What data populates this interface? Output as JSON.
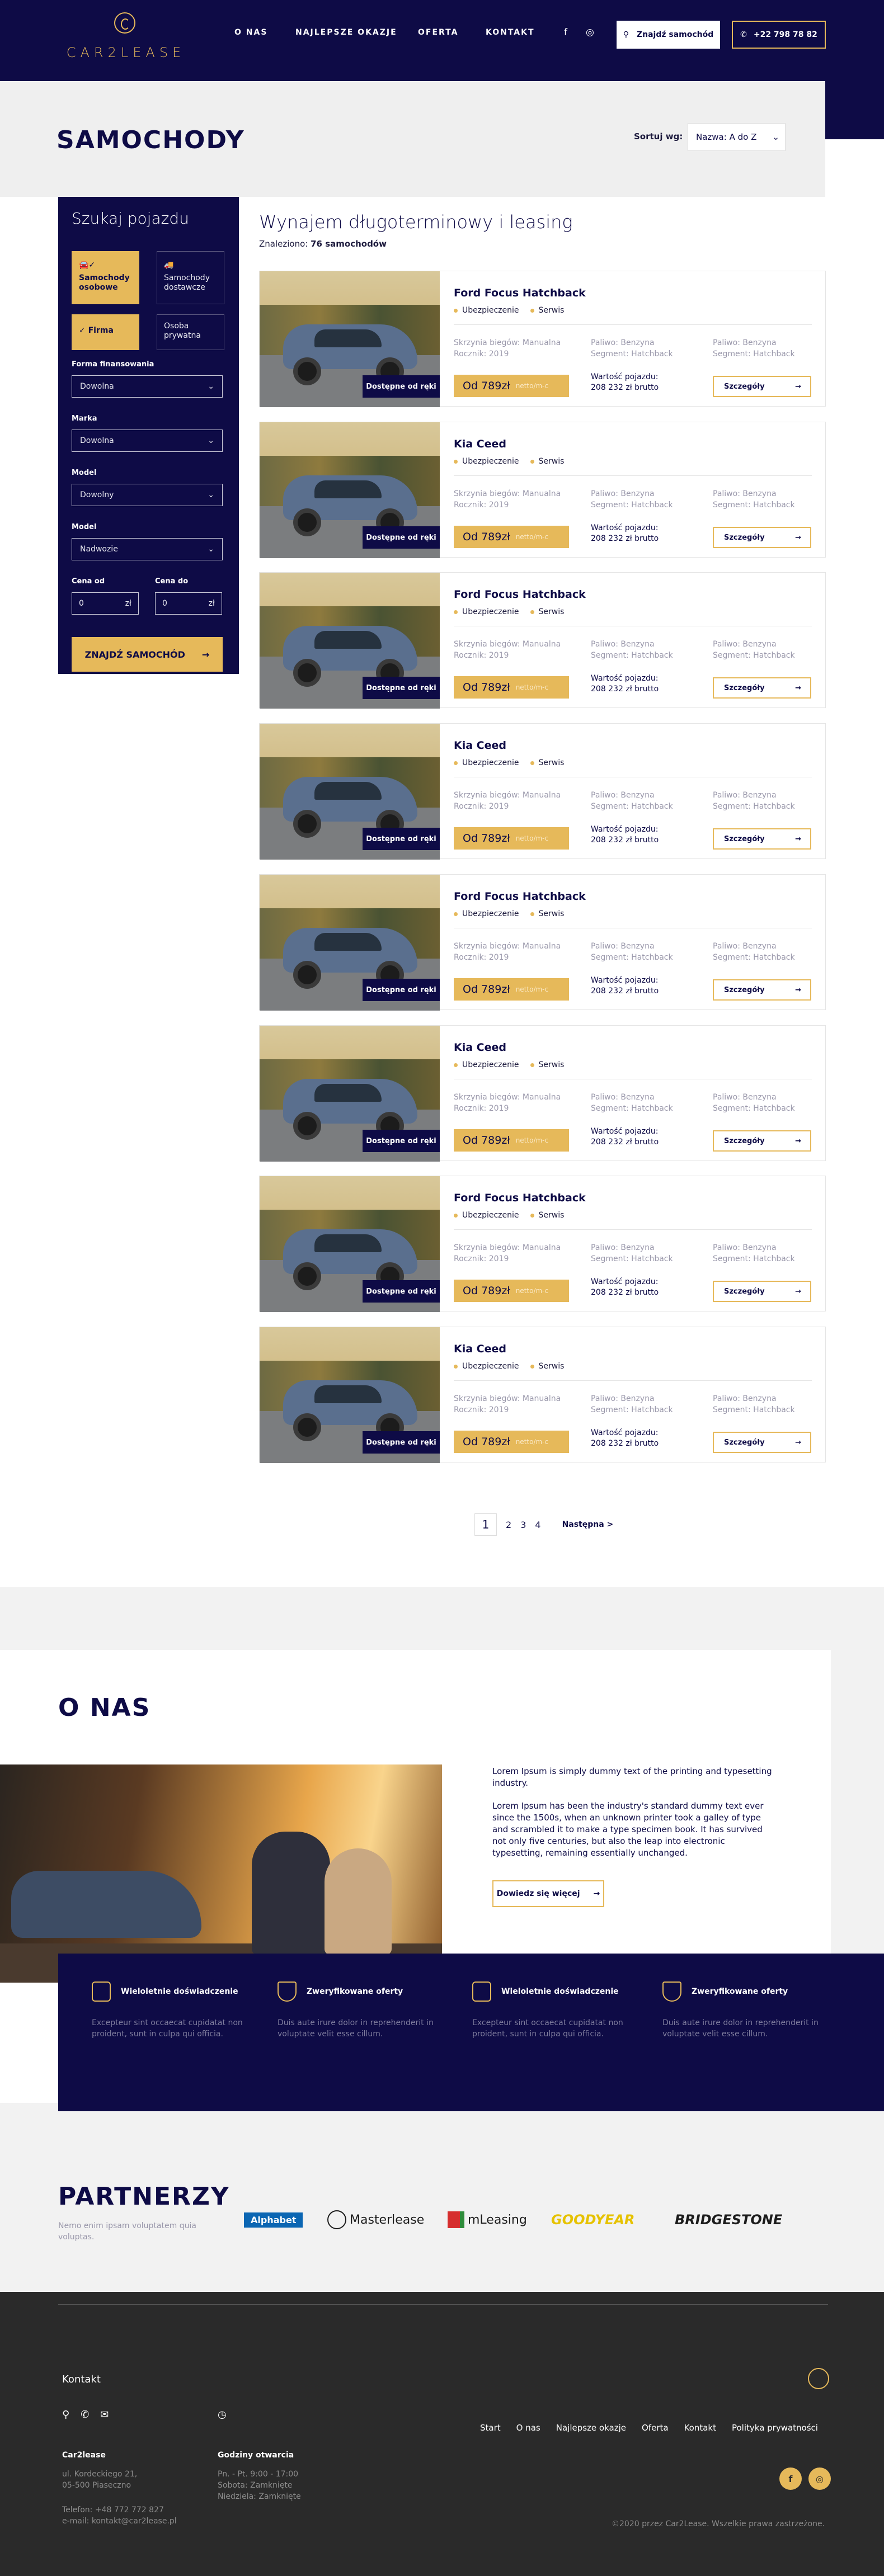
{
  "brand": {
    "logo_text": "CAR2LEASE"
  },
  "nav": {
    "items": [
      "O NAS",
      "NAJLEPSZE OKAZJE",
      "OFERTA",
      "KONTAKT"
    ]
  },
  "header": {
    "find_button": "Znajdź samochód",
    "phone": "+22 798 78 82"
  },
  "hero": {
    "title": "SAMOCHODY",
    "sort_label": "Sortuj wg:",
    "sort_value": "Nazwa: A do Z"
  },
  "filter": {
    "title": "Szukaj pojazdu",
    "vehicle_types": [
      "Samochody osobowe",
      "Samochody dostawcze"
    ],
    "client_types": [
      "Firma",
      "Osoba prywatna"
    ],
    "fields": [
      {
        "label": "Forma finansowania",
        "value": "Dowolna"
      },
      {
        "label": "Marka",
        "value": "Dowolna"
      },
      {
        "label": "Model",
        "value": "Dowolny"
      },
      {
        "label": "Model",
        "value": "Nadwozie"
      }
    ],
    "price_from_label": "Cena od",
    "price_to_label": "Cena do",
    "price_from": "0",
    "price_to": "0",
    "currency": "zł",
    "submit": "ZNAJDŹ SAMOCHÓD"
  },
  "listing": {
    "title": "Wynajem długoterminowy i leasing",
    "found_prefix": "Znaleziono:",
    "found_count": "76 samochodów",
    "cars": [
      {
        "name": "Ford Focus Hatchback",
        "badge": "Dostępne od ręki",
        "tags": [
          "Ubezpieczenie",
          "Serwis"
        ],
        "specs": [
          "Skrzynia biegów: Manualna",
          "Rocznik: 2019",
          "Paliwo: Benzyna",
          "Segment: Hatchback",
          "Paliwo: Benzyna",
          "Segment: Hatchback"
        ],
        "price": "Od 789zł",
        "price_note": "netto/m-c",
        "value_label": "Wartość pojazdu:",
        "value": "208 232 zł brutto",
        "details": "Szczegóły"
      },
      {
        "name": "Kia Ceed",
        "badge": "Dostępne od ręki",
        "tags": [
          "Ubezpieczenie",
          "Serwis"
        ],
        "specs": [
          "Skrzynia biegów: Manualna",
          "Rocznik: 2019",
          "Paliwo: Benzyna",
          "Segment: Hatchback",
          "Paliwo: Benzyna",
          "Segment: Hatchback"
        ],
        "price": "Od 789zł",
        "price_note": "netto/m-c",
        "value_label": "Wartość pojazdu:",
        "value": "208 232 zł brutto",
        "details": "Szczegóły"
      },
      {
        "name": "Ford Focus Hatchback",
        "badge": "Dostępne od ręki",
        "tags": [
          "Ubezpieczenie",
          "Serwis"
        ],
        "specs": [
          "Skrzynia biegów: Manualna",
          "Rocznik: 2019",
          "Paliwo: Benzyna",
          "Segment: Hatchback",
          "Paliwo: Benzyna",
          "Segment: Hatchback"
        ],
        "price": "Od 789zł",
        "price_note": "netto/m-c",
        "value_label": "Wartość pojazdu:",
        "value": "208 232 zł brutto",
        "details": "Szczegóły"
      },
      {
        "name": "Kia Ceed",
        "badge": "Dostępne od ręki",
        "tags": [
          "Ubezpieczenie",
          "Serwis"
        ],
        "specs": [
          "Skrzynia biegów: Manualna",
          "Rocznik: 2019",
          "Paliwo: Benzyna",
          "Segment: Hatchback",
          "Paliwo: Benzyna",
          "Segment: Hatchback"
        ],
        "price": "Od 789zł",
        "price_note": "netto/m-c",
        "value_label": "Wartość pojazdu:",
        "value": "208 232 zł brutto",
        "details": "Szczegóły"
      },
      {
        "name": "Ford Focus Hatchback",
        "badge": "Dostępne od ręki",
        "tags": [
          "Ubezpieczenie",
          "Serwis"
        ],
        "specs": [
          "Skrzynia biegów: Manualna",
          "Rocznik: 2019",
          "Paliwo: Benzyna",
          "Segment: Hatchback",
          "Paliwo: Benzyna",
          "Segment: Hatchback"
        ],
        "price": "Od 789zł",
        "price_note": "netto/m-c",
        "value_label": "Wartość pojazdu:",
        "value": "208 232 zł brutto",
        "details": "Szczegóły"
      },
      {
        "name": "Kia Ceed",
        "badge": "Dostępne od ręki",
        "tags": [
          "Ubezpieczenie",
          "Serwis"
        ],
        "specs": [
          "Skrzynia biegów: Manualna",
          "Rocznik: 2019",
          "Paliwo: Benzyna",
          "Segment: Hatchback",
          "Paliwo: Benzyna",
          "Segment: Hatchback"
        ],
        "price": "Od 789zł",
        "price_note": "netto/m-c",
        "value_label": "Wartość pojazdu:",
        "value": "208 232 zł brutto",
        "details": "Szczegóły"
      },
      {
        "name": "Ford Focus Hatchback",
        "badge": "Dostępne od ręki",
        "tags": [
          "Ubezpieczenie",
          "Serwis"
        ],
        "specs": [
          "Skrzynia biegów: Manualna",
          "Rocznik: 2019",
          "Paliwo: Benzyna",
          "Segment: Hatchback",
          "Paliwo: Benzyna",
          "Segment: Hatchback"
        ],
        "price": "Od 789zł",
        "price_note": "netto/m-c",
        "value_label": "Wartość pojazdu:",
        "value": "208 232 zł brutto",
        "details": "Szczegóły"
      },
      {
        "name": "Kia Ceed",
        "badge": "Dostępne od ręki",
        "tags": [
          "Ubezpieczenie",
          "Serwis"
        ],
        "specs": [
          "Skrzynia biegów: Manualna",
          "Rocznik: 2019",
          "Paliwo: Benzyna",
          "Segment: Hatchback",
          "Paliwo: Benzyna",
          "Segment: Hatchback"
        ],
        "price": "Od 789zł",
        "price_note": "netto/m-c",
        "value_label": "Wartość pojazdu:",
        "value": "208 232 zł brutto",
        "details": "Szczegóły"
      }
    ]
  },
  "pagination": {
    "current": "1",
    "pages": [
      "2",
      "3",
      "4"
    ],
    "next": "Następna >"
  },
  "about": {
    "title": "O NAS",
    "paragraphs": [
      "Lorem Ipsum is simply dummy text of the printing and typesetting industry.",
      "Lorem Ipsum has been the industry's standard dummy text ever since the 1500s, when an unknown printer took a galley of type and scrambled it to make a type specimen book. It has survived not only five centuries, but also the leap into electronic typesetting, remaining essentially unchanged."
    ],
    "more_button": "Dowiedz się więcej"
  },
  "features": [
    {
      "icon": "calendar-icon",
      "title": "Wieloletnie doświadczenie",
      "text": "Excepteur sint occaecat cupidatat non proident, sunt in culpa qui officia."
    },
    {
      "icon": "shield-icon",
      "title": "Zweryfikowane oferty",
      "text": "Duis aute irure dolor in reprehenderit in voluptate velit esse cillum."
    },
    {
      "icon": "calendar-icon",
      "title": "Wieloletnie doświadczenie",
      "text": "Excepteur sint occaecat cupidatat non proident, sunt in culpa qui officia."
    },
    {
      "icon": "shield-icon",
      "title": "Zweryfikowane oferty",
      "text": "Duis aute irure dolor in reprehenderit in voluptate velit esse cillum."
    }
  ],
  "partners": {
    "title": "PARTNERZY",
    "subtitle": "Nemo enim ipsam voluptatem quia voluptas.",
    "logos": [
      "Alphabet",
      "Masterlease",
      "mLeasing",
      "GOODYEAR",
      "BRIDGESTONE"
    ]
  },
  "footer": {
    "contact_title": "Kontakt",
    "nav": [
      "Start",
      "O nas",
      "Najlepsze okazje",
      "Oferta",
      "Kontakt",
      "Polityka prywatności"
    ],
    "company": {
      "name": "Car2lease",
      "address_1": "ul. Kordeckiego 21,",
      "address_2": "05-500 Piaseczno",
      "phone": "Telefon: +48 772 772 827",
      "email": "e-mail: kontakt@car2lease.pl"
    },
    "hours": {
      "title": "Godziny otwarcia",
      "weekdays": "Pn. - Pt. 9:00 - 17:00",
      "saturday": "Sobota: Zamknięte",
      "sunday": "Niedziela: Zamknięte"
    },
    "social": [
      "f",
      "◎"
    ],
    "copyright": "©2020 przez Car2Lease. Wszelkie prawa zastrzeżone."
  },
  "colors": {
    "navy": "#0e0b46",
    "gold": "#e6b95a",
    "footer": "#2a2a2a"
  }
}
